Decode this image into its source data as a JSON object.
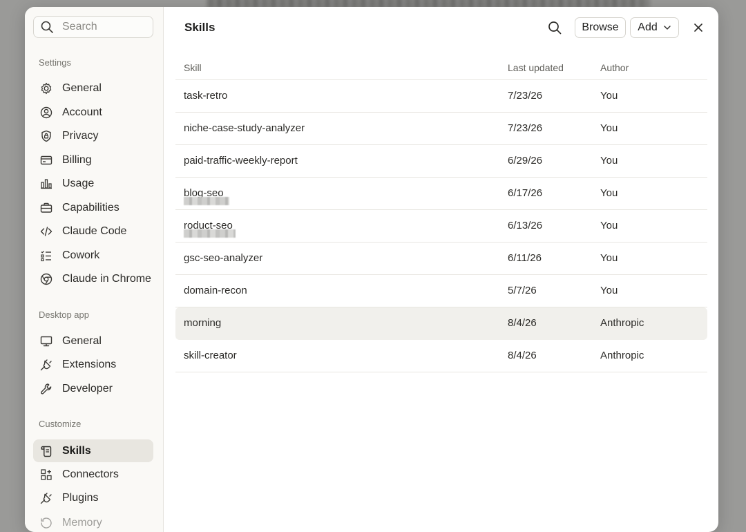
{
  "sidebar": {
    "search_placeholder": "Search",
    "sections": [
      {
        "title": "Settings",
        "items": [
          {
            "label": "General",
            "icon": "gear-icon"
          },
          {
            "label": "Account",
            "icon": "user-circle-icon"
          },
          {
            "label": "Privacy",
            "icon": "shield-lock-icon"
          },
          {
            "label": "Billing",
            "icon": "credit-card-icon"
          },
          {
            "label": "Usage",
            "icon": "bar-chart-icon"
          },
          {
            "label": "Capabilities",
            "icon": "briefcase-icon"
          },
          {
            "label": "Claude Code",
            "icon": "code-icon"
          },
          {
            "label": "Cowork",
            "icon": "checklist-icon"
          },
          {
            "label": "Claude in Chrome",
            "icon": "chrome-icon"
          }
        ]
      },
      {
        "title": "Desktop app",
        "items": [
          {
            "label": "General",
            "icon": "monitor-icon"
          },
          {
            "label": "Extensions",
            "icon": "plug-icon"
          },
          {
            "label": "Developer",
            "icon": "wrench-icon"
          }
        ]
      },
      {
        "title": "Customize",
        "items": [
          {
            "label": "Skills",
            "icon": "scroll-icon",
            "active": true
          },
          {
            "label": "Connectors",
            "icon": "grid-plus-icon"
          },
          {
            "label": "Plugins",
            "icon": "plug-icon"
          },
          {
            "label": "Memory",
            "icon": "memory-icon"
          }
        ]
      }
    ]
  },
  "main": {
    "title": "Skills",
    "browse_label": "Browse",
    "add_label": "Add",
    "columns": [
      "Skill",
      "Last updated",
      "Author"
    ],
    "rows": [
      {
        "skill": "task-retro",
        "updated": "7/23/26",
        "author": "You"
      },
      {
        "skill": "niche-case-study-analyzer",
        "updated": "7/23/26",
        "author": "You"
      },
      {
        "skill": "paid-traffic-weekly-report",
        "updated": "6/29/26",
        "author": "You"
      },
      {
        "skill_visible": "blog-seo",
        "updated": "6/17/26",
        "author": "You",
        "redacted": true
      },
      {
        "skill_visible": "roduct-seo",
        "updated": "6/13/26",
        "author": "You",
        "redacted": true
      },
      {
        "skill": "gsc-seo-analyzer",
        "updated": "6/11/26",
        "author": "You"
      },
      {
        "skill": "domain-recon",
        "updated": "5/7/26",
        "author": "You"
      },
      {
        "skill": "morning",
        "updated": "8/4/26",
        "author": "Anthropic",
        "highlighted": true
      },
      {
        "skill": "skill-creator",
        "updated": "8/4/26",
        "author": "Anthropic"
      }
    ]
  },
  "colors": {
    "backdrop": "#9a9a98",
    "sidebar_bg": "#faf9f6",
    "active_item_bg": "#e8e6e0",
    "highlight_row_bg": "#f1f0ec"
  }
}
